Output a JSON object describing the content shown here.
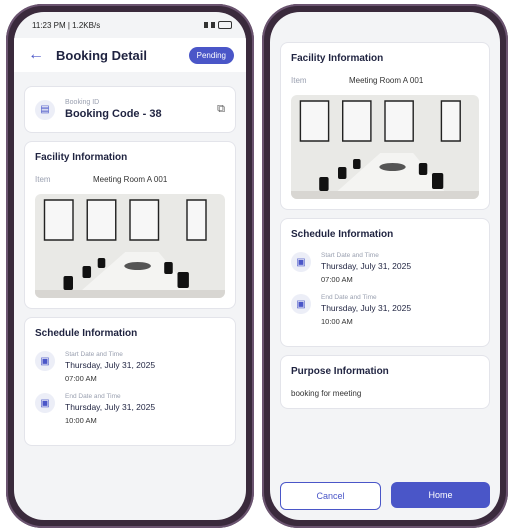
{
  "status": {
    "time_speed": "11:23 PM | 1.2KB/s"
  },
  "header": {
    "title": "Booking Detail",
    "status_badge": "Pending"
  },
  "booking": {
    "id_label": "Booking ID",
    "code": "Booking Code - 38"
  },
  "facility": {
    "title": "Facility Information",
    "item_label": "Item",
    "item_value": "Meeting Room A 001"
  },
  "schedule": {
    "title": "Schedule Information",
    "start_label": "Start Date and Time",
    "start_date": "Thursday, July 31, 2025",
    "start_time": "07:00 AM",
    "end_label": "End Date and Time",
    "end_date": "Thursday, July 31, 2025",
    "end_time": "10:00 AM"
  },
  "purpose": {
    "title": "Purpose Information",
    "text": "booking for meeting"
  },
  "actions": {
    "cancel": "Cancel",
    "home": "Home"
  },
  "colors": {
    "accent": "#4a56c8",
    "phone_frame": "#3a2a3c"
  }
}
